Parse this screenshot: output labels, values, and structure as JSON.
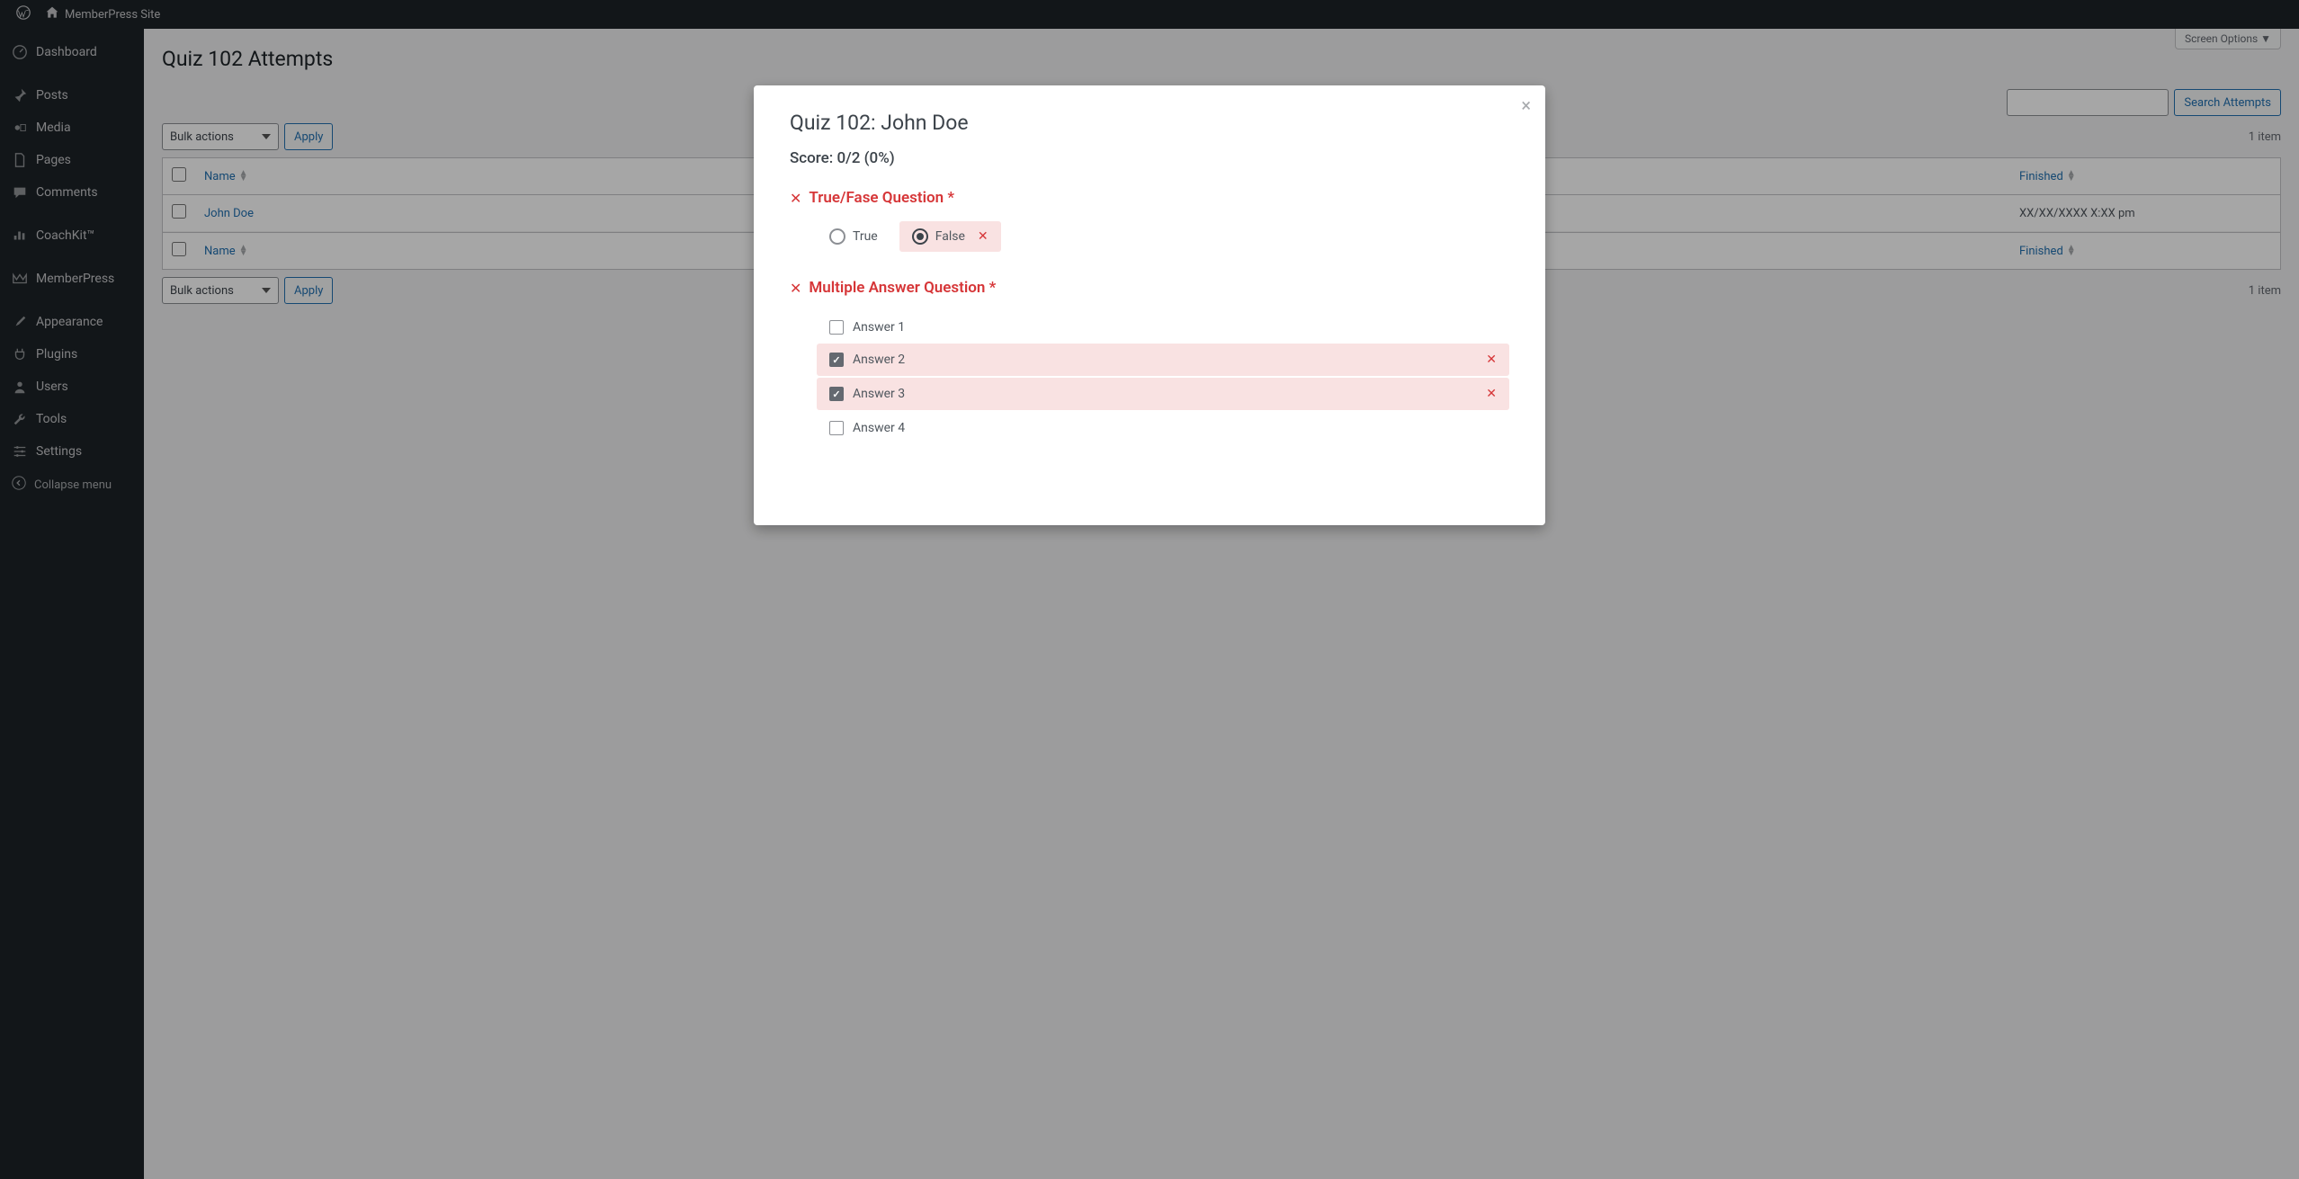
{
  "admin_bar": {
    "site_name": "MemberPress Site"
  },
  "sidebar": {
    "items": [
      {
        "label": "Dashboard",
        "icon": "dashboard"
      },
      {
        "label": "Posts",
        "icon": "posts"
      },
      {
        "label": "Media",
        "icon": "media"
      },
      {
        "label": "Pages",
        "icon": "pages"
      },
      {
        "label": "Comments",
        "icon": "comments"
      },
      {
        "label": "CoachKit™",
        "icon": "coachkit"
      },
      {
        "label": "MemberPress",
        "icon": "memberpress"
      },
      {
        "label": "Appearance",
        "icon": "appearance"
      },
      {
        "label": "Plugins",
        "icon": "plugins"
      },
      {
        "label": "Users",
        "icon": "users"
      },
      {
        "label": "Tools",
        "icon": "tools"
      },
      {
        "label": "Settings",
        "icon": "settings"
      }
    ],
    "collapse_label": "Collapse menu"
  },
  "page": {
    "title": "Quiz 102 Attempts",
    "screen_options_label": "Screen Options ▼",
    "bulk_actions_selected": "Bulk actions",
    "apply_label": "Apply",
    "search_label": "Search Attempts",
    "count_text": "1 item",
    "table": {
      "columns": {
        "name": "Name",
        "finished": "Finished"
      },
      "rows": [
        {
          "name": "John Doe",
          "finished": "XX/XX/XXXX X:XX pm"
        }
      ]
    }
  },
  "modal": {
    "title": "Quiz 102: John Doe",
    "score": "Score: 0/2 (0%)",
    "questions": [
      {
        "status": "wrong",
        "title": "True/Fase Question *",
        "type": "radio",
        "answers": [
          {
            "label": "True",
            "selected": false,
            "wrong": false
          },
          {
            "label": "False",
            "selected": true,
            "wrong": true
          }
        ]
      },
      {
        "status": "wrong",
        "title": "Multiple Answer Question *",
        "type": "checkbox",
        "answers": [
          {
            "label": "Answer 1",
            "selected": false,
            "wrong": false
          },
          {
            "label": "Answer 2",
            "selected": true,
            "wrong": true
          },
          {
            "label": "Answer 3",
            "selected": true,
            "wrong": true
          },
          {
            "label": "Answer 4",
            "selected": false,
            "wrong": false
          }
        ]
      }
    ]
  }
}
